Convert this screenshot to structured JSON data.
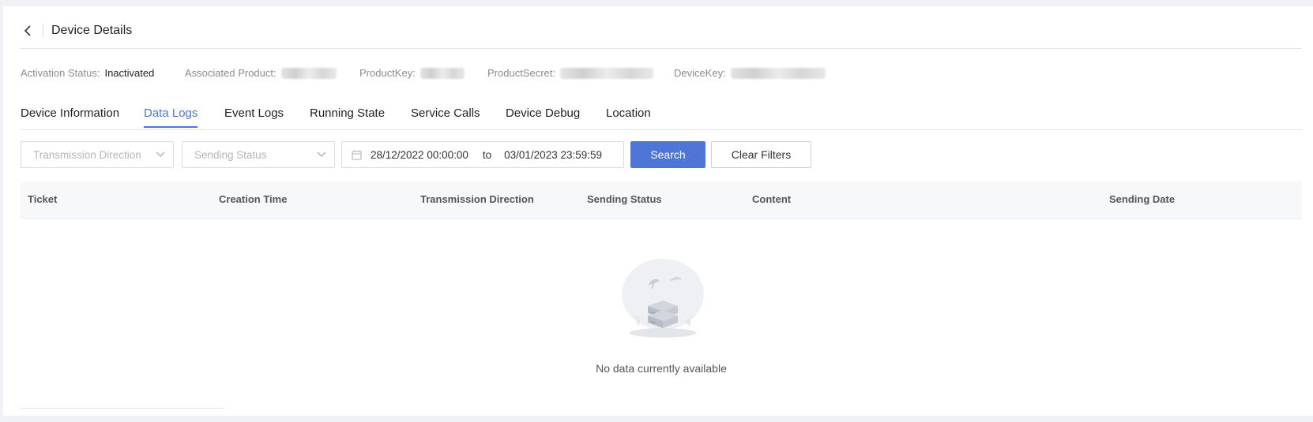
{
  "header": {
    "title": "Device Details",
    "back_icon": "chevron-left-icon"
  },
  "info": {
    "activation_label": "Activation Status:",
    "activation_value": "Inactivated",
    "product_label": "Associated Product:",
    "productkey_label": "ProductKey:",
    "productsecret_label": "ProductSecret:",
    "devicekey_label": "DeviceKey:"
  },
  "tabs": [
    {
      "label": "Device Information",
      "active": false
    },
    {
      "label": "Data Logs",
      "active": true
    },
    {
      "label": "Event Logs",
      "active": false
    },
    {
      "label": "Running State",
      "active": false
    },
    {
      "label": "Service Calls",
      "active": false
    },
    {
      "label": "Device Debug",
      "active": false
    },
    {
      "label": "Location",
      "active": false
    }
  ],
  "filters": {
    "direction_placeholder": "Transmission Direction",
    "status_placeholder": "Sending Status",
    "date_start": "28/12/2022 00:00:00",
    "date_sep": "to",
    "date_end": "03/01/2023 23:59:59",
    "search_label": "Search",
    "clear_label": "Clear Filters"
  },
  "table": {
    "columns": [
      "Ticket",
      "Creation Time",
      "Transmission Direction",
      "Sending Status",
      "Content",
      "Sending Date"
    ],
    "empty_text": "No data currently available"
  },
  "colors": {
    "accent": "#4f75d6",
    "page_bg": "#f0f1f5"
  }
}
